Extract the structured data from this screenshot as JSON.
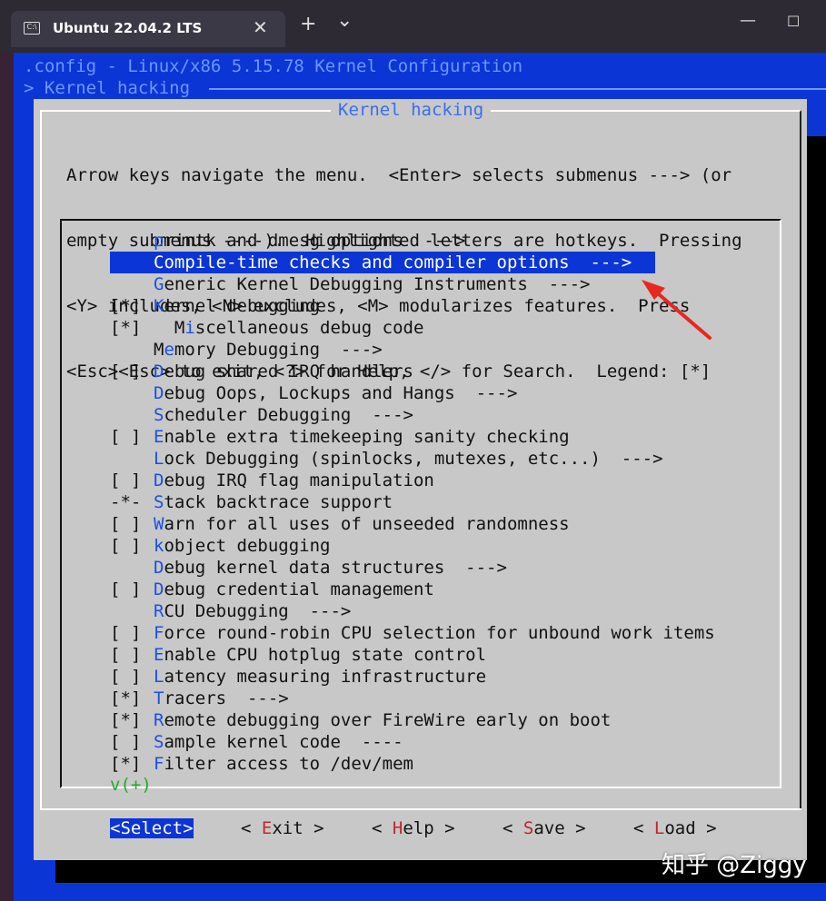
{
  "window": {
    "tab_title": "Ubuntu 22.04.2 LTS",
    "tab_icon": "terminal-icon",
    "new_tab_glyph": "+",
    "dropdown_glyph": "⌄"
  },
  "terminal": {
    "config_line": ".config - Linux/x86 5.15.78 Kernel Configuration",
    "breadcrumb": "> Kernel hacking"
  },
  "dialog": {
    "title": "Kernel hacking",
    "help_lines": [
      "Arrow keys navigate the menu.  <Enter> selects submenus ---> (or",
      "empty submenus ----).  Highlighted letters are hotkeys.  Pressing",
      "<Y> includes, <N> excludes, <M> modularizes features.  Press",
      "<Esc><Esc> to exit, <?> for Help, </> for Search.  Legend: [*]"
    ],
    "menu_items": [
      {
        "prefix": "",
        "hotkey": "p",
        "rest": "rintk and dmesg options  --->",
        "selected": false
      },
      {
        "prefix": "",
        "hotkey": "C",
        "rest": "ompile-time checks and compiler options  --->",
        "selected": true
      },
      {
        "prefix": "",
        "hotkey": "G",
        "rest": "eneric Kernel Debugging Instruments  --->",
        "selected": false
      },
      {
        "prefix": "[*] ",
        "hotkey": "K",
        "rest": "ernel debugging",
        "selected": false
      },
      {
        "prefix": "[*] ",
        "lead": "  M",
        "hotkey": "i",
        "rest": "scellaneous debug code",
        "selected": false
      },
      {
        "prefix": "",
        "lead": "M",
        "hotkey": "e",
        "rest": "mory Debugging  --->",
        "selected": false
      },
      {
        "prefix": "[ ] ",
        "hotkey": "D",
        "rest": "ebug shared IRQ handlers",
        "selected": false
      },
      {
        "prefix": "",
        "hotkey": "D",
        "rest": "ebug Oops, Lockups and Hangs  --->",
        "selected": false
      },
      {
        "prefix": "",
        "hotkey": "S",
        "rest": "cheduler Debugging  --->",
        "selected": false
      },
      {
        "prefix": "[ ] ",
        "hotkey": "E",
        "rest": "nable extra timekeeping sanity checking",
        "selected": false
      },
      {
        "prefix": "",
        "hotkey": "L",
        "rest": "ock Debugging (spinlocks, mutexes, etc...)  --->",
        "selected": false
      },
      {
        "prefix": "[ ] ",
        "hotkey": "D",
        "rest": "ebug IRQ flag manipulation",
        "selected": false
      },
      {
        "prefix": "-*- ",
        "hotkey": "S",
        "rest": "tack backtrace support",
        "selected": false
      },
      {
        "prefix": "[ ] ",
        "hotkey": "W",
        "rest": "arn for all uses of unseeded randomness",
        "selected": false
      },
      {
        "prefix": "[ ] ",
        "hotkey": "k",
        "rest": "object debugging",
        "selected": false
      },
      {
        "prefix": "",
        "hotkey": "D",
        "rest": "ebug kernel data structures  --->",
        "selected": false
      },
      {
        "prefix": "[ ] ",
        "hotkey": "D",
        "rest": "ebug credential management",
        "selected": false
      },
      {
        "prefix": "",
        "hotkey": "R",
        "rest": "CU Debugging  --->",
        "selected": false
      },
      {
        "prefix": "[ ] ",
        "hotkey": "F",
        "rest": "orce round-robin CPU selection for unbound work items",
        "selected": false
      },
      {
        "prefix": "[ ] ",
        "hotkey": "E",
        "rest": "nable CPU hotplug state control",
        "selected": false
      },
      {
        "prefix": "[ ] ",
        "hotkey": "L",
        "rest": "atency measuring infrastructure",
        "selected": false
      },
      {
        "prefix": "[*] ",
        "hotkey": "T",
        "rest": "racers  --->",
        "selected": false
      },
      {
        "prefix": "[*] ",
        "hotkey": "R",
        "rest": "emote debugging over FireWire early on boot",
        "selected": false
      },
      {
        "prefix": "[ ] ",
        "hotkey": "S",
        "rest": "ample kernel code  ----",
        "selected": false
      },
      {
        "prefix": "[*] ",
        "hotkey": "F",
        "rest": "ilter access to /dev/mem",
        "selected": false
      }
    ],
    "more_indicator": "v(+)",
    "buttons": [
      {
        "pre": "<Select>",
        "hotkey": "",
        "post": "",
        "active": true
      },
      {
        "pre": "< ",
        "hotkey": "E",
        "post": "xit >",
        "active": false
      },
      {
        "pre": "< ",
        "hotkey": "H",
        "post": "elp >",
        "active": false
      },
      {
        "pre": "< ",
        "hotkey": "S",
        "post": "ave >",
        "active": false
      },
      {
        "pre": "< ",
        "hotkey": "L",
        "post": "oad >",
        "active": false
      }
    ]
  },
  "watermark": "知乎 @Ziggy",
  "colors": {
    "terminal_bg": "#0c35d6",
    "dialog_bg": "#c8c8c8",
    "hotkey_menu": "#1a4fe6",
    "hotkey_button": "#c0262e",
    "annotation_arrow": "#e8281e"
  }
}
